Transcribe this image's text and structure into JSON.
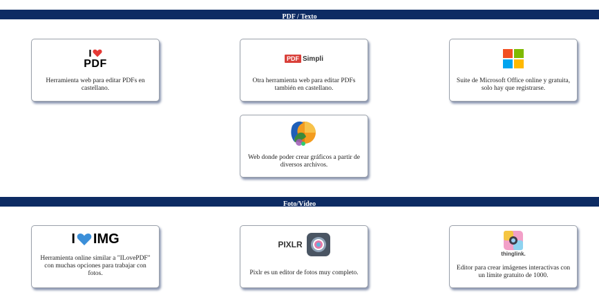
{
  "sections": [
    {
      "title": "PDF / Texto"
    },
    {
      "title": "Foto/Vídeo"
    }
  ],
  "pdf_cards": [
    {
      "logo_icon": "ilovepdf-logo",
      "logo_text_top": "I",
      "logo_text_bottom": "PDF",
      "description": "Herramienta web para editar PDFs en castellano."
    },
    {
      "logo_icon": "pdfsimpli-logo",
      "logo_box": "PDF",
      "logo_text": "Simpli",
      "description": "Otra herramienta web para editar PDFs también en castellano."
    },
    {
      "logo_icon": "microsoft-logo",
      "description": "Suite de Microsoft Office online y gratuita, solo hay que registrarse."
    },
    {
      "logo_icon": "chart-globe-logo",
      "description": "Web donde poder crear gráficos a partir de diversos archivos."
    }
  ],
  "media_cards": [
    {
      "logo_icon": "iloveimg-logo",
      "logo_text_left": "I",
      "logo_text_right": "IMG",
      "description": "Herramienta online similar a \"ILovePDF\" con muchas opciones para trabajar con fotos."
    },
    {
      "logo_icon": "pixlr-logo",
      "logo_text": "PIXLR",
      "description": "Pixlr es un editor de fotos muy completo."
    },
    {
      "logo_icon": "thinglink-logo",
      "logo_text": "thinglink.",
      "description": "Editor para crear imágenes interactivas con un límite gratuito de 1000."
    }
  ],
  "colors": {
    "section_bar": "#0d2b63",
    "heart_red": "#e53935",
    "heart_blue": "#3b8fd9",
    "pdfsimpli_red": "#d9403a"
  }
}
